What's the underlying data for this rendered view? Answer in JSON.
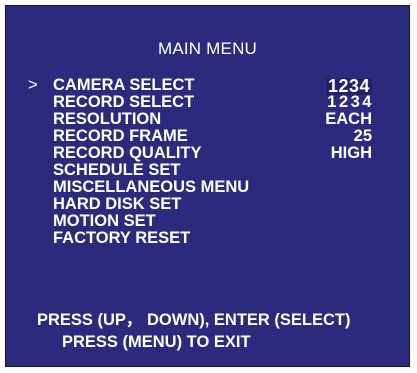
{
  "screen": {
    "title": "MAIN MENU",
    "cursor": ">",
    "items": [
      {
        "label": "CAMERA SELECT",
        "value": "1234"
      },
      {
        "label": "RECORD SELECT",
        "value": "1234"
      },
      {
        "label": "RESOLUTION",
        "value": "EACH"
      },
      {
        "label": "RECORD FRAME",
        "value": "25"
      },
      {
        "label": "RECORD QUALITY",
        "value": "HIGH"
      },
      {
        "label": "SCHEDULE SET",
        "value": ""
      },
      {
        "label": "MISCELLANEOUS MENU",
        "value": ""
      },
      {
        "label": "HARD DISK SET",
        "value": ""
      },
      {
        "label": "MOTION SET",
        "value": ""
      },
      {
        "label": "FACTORY RESET",
        "value": ""
      }
    ],
    "footer": {
      "line1": "PRESS (UP， DOWN), ENTER (SELECT)",
      "line2": "PRESS (MENU) TO EXIT"
    }
  },
  "colors": {
    "background": "#2c2a7c",
    "text": "#ffffff",
    "highlight": "#232068"
  }
}
